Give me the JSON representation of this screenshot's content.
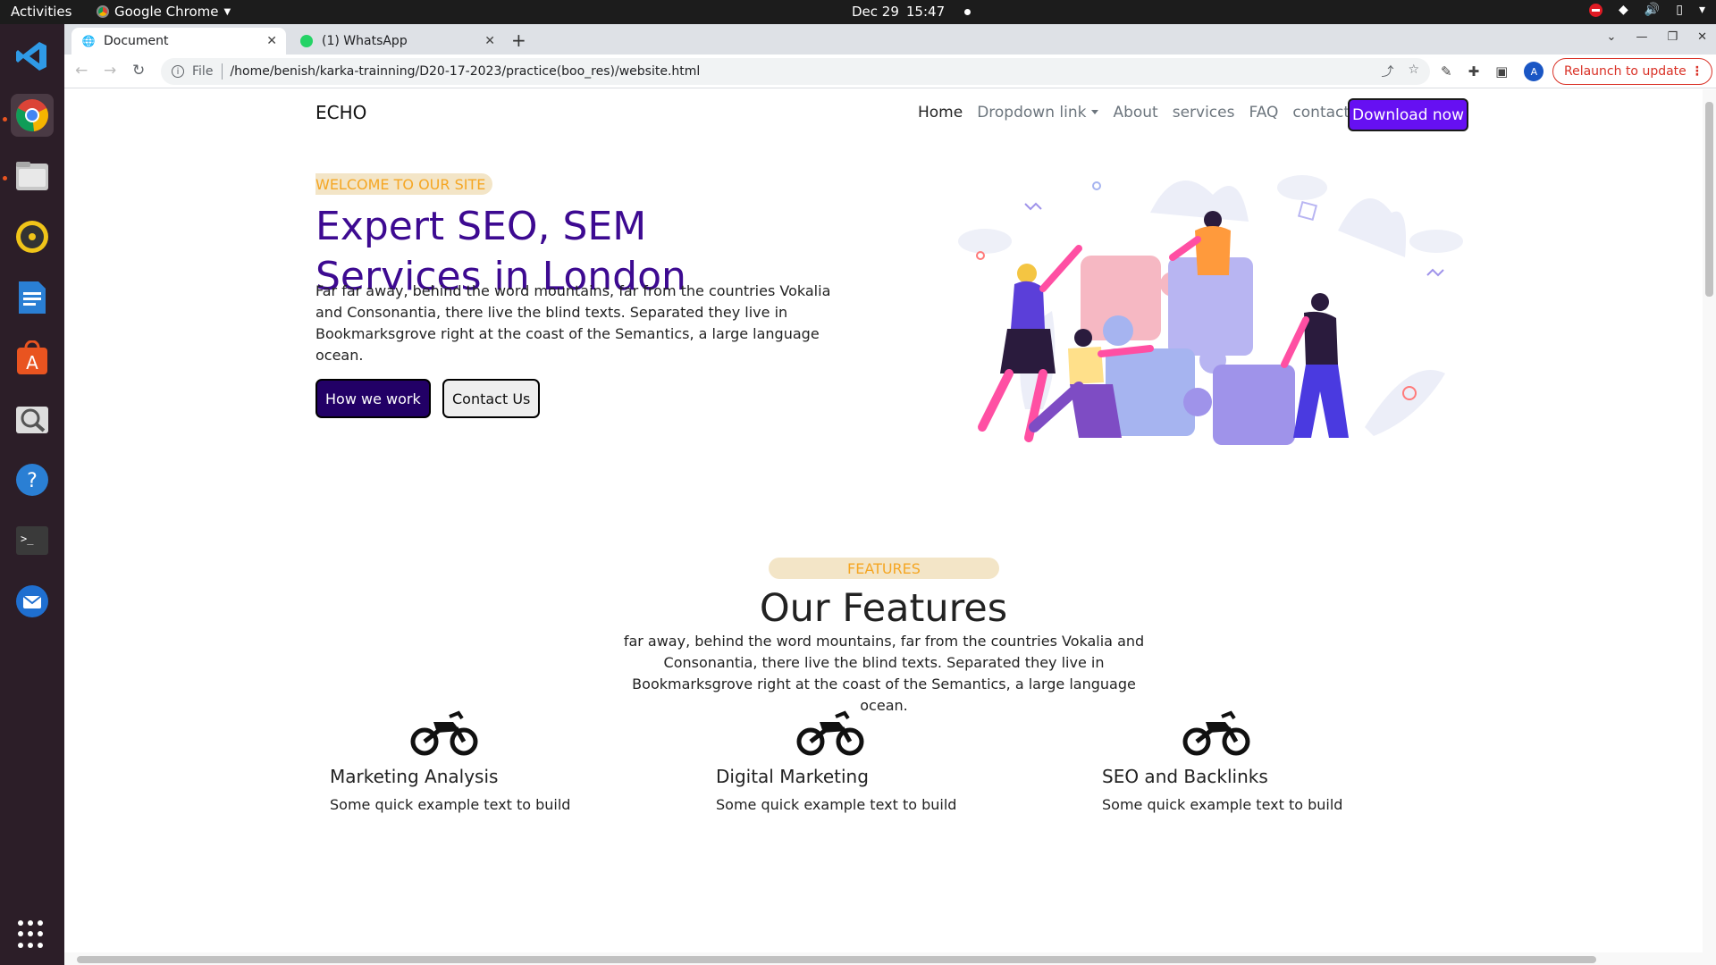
{
  "os_topbar": {
    "activities": "Activities",
    "app_name": "Google Chrome",
    "date": "Dec 29",
    "time": "15:47"
  },
  "dock": {
    "apps": [
      "vscode-icon",
      "chrome-icon",
      "files-icon",
      "rhythmbox-icon",
      "writer-icon",
      "software-icon",
      "image-viewer-icon",
      "help-icon",
      "terminal-icon",
      "thunderbird-icon"
    ]
  },
  "browser": {
    "tabs": [
      {
        "label": "Document",
        "active": true
      },
      {
        "label": "(1) WhatsApp",
        "active": false
      }
    ],
    "address": {
      "scheme_label": "File",
      "url": "/home/benish/karka-trainning/D20-17-2023/practice(boo_res)/website.html"
    },
    "profile_initial": "A",
    "relaunch_label": "Relaunch to update"
  },
  "site": {
    "brand": "ECHO",
    "nav": {
      "home": "Home",
      "dropdown": "Dropdown link",
      "about": "About",
      "services": "services",
      "faq": "FAQ",
      "contact": "contact Us",
      "download": "Download now"
    },
    "hero": {
      "badge": "WELCOME TO OUR SITE",
      "title_line1": "Expert SEO, SEM",
      "title_line2": "Services in London",
      "text": "Far far away, behind the word mountains, far from the countries Vokalia and Consonantia, there live the blind texts. Separated they live in Bookmarksgrove right at the coast of the Semantics, a large language ocean.",
      "btn_primary": "How we work",
      "btn_secondary": "Contact Us"
    },
    "features": {
      "badge": "FEATURES",
      "title": "Our Features",
      "text": "far away, behind the word mountains, far from the countries Vokalia and Consonantia, there live the blind texts. Separated they live in Bookmarksgrove right at the coast of the Semantics, a large language ocean.",
      "cards": [
        {
          "icon": "motorcycle-icon",
          "title": "Marketing Analysis",
          "text": "Some quick example text to build"
        },
        {
          "icon": "motorcycle-icon",
          "title": "Digital Marketing",
          "text": "Some quick example text to build"
        },
        {
          "icon": "motorcycle-icon",
          "title": "SEO and Backlinks",
          "text": "Some quick example text to build"
        }
      ]
    }
  },
  "colors": {
    "brand_purple": "#3d0a91",
    "download_btn": "#6610f2",
    "badge_bg": "#f3e5c7",
    "badge_text": "#f5a623",
    "relaunch_red": "#d93025"
  }
}
